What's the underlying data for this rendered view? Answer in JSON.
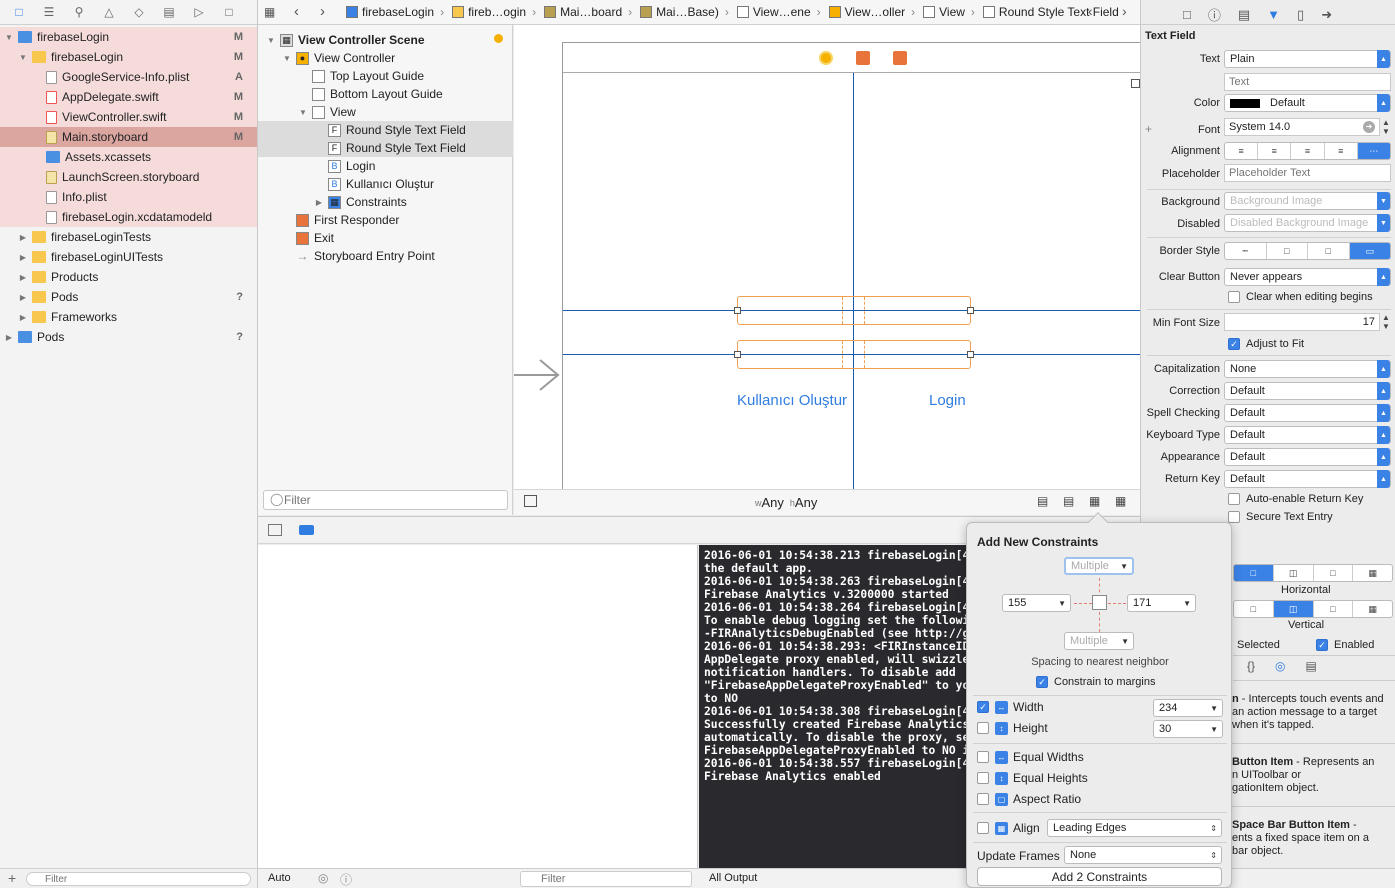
{
  "navigator": {
    "rows": [
      {
        "label": "firebaseLogin",
        "badge": "M",
        "kind": "project",
        "indent": 0,
        "disclosure": "open"
      },
      {
        "label": "firebaseLogin",
        "badge": "M",
        "kind": "folder",
        "indent": 1,
        "disclosure": "open"
      },
      {
        "label": "GoogleService-Info.plist",
        "badge": "A",
        "kind": "file",
        "indent": 2,
        "disclosure": ""
      },
      {
        "label": "AppDelegate.swift",
        "badge": "M",
        "kind": "swift",
        "indent": 2,
        "disclosure": ""
      },
      {
        "label": "ViewController.swift",
        "badge": "M",
        "kind": "swift",
        "indent": 2,
        "disclosure": ""
      },
      {
        "label": "Main.storyboard",
        "badge": "M",
        "kind": "storyboard",
        "indent": 2,
        "disclosure": ""
      },
      {
        "label": "Assets.xcassets",
        "badge": "",
        "kind": "assets",
        "indent": 2,
        "disclosure": ""
      },
      {
        "label": "LaunchScreen.storyboard",
        "badge": "",
        "kind": "storyboard",
        "indent": 2,
        "disclosure": ""
      },
      {
        "label": "Info.plist",
        "badge": "",
        "kind": "file",
        "indent": 2,
        "disclosure": ""
      },
      {
        "label": "firebaseLogin.xcdatamodeld",
        "badge": "",
        "kind": "file",
        "indent": 2,
        "disclosure": ""
      },
      {
        "label": "firebaseLoginTests",
        "badge": "",
        "kind": "folder",
        "indent": 1,
        "disclosure": "closed"
      },
      {
        "label": "firebaseLoginUITests",
        "badge": "",
        "kind": "folder",
        "indent": 1,
        "disclosure": "closed"
      },
      {
        "label": "Products",
        "badge": "",
        "kind": "folder",
        "indent": 1,
        "disclosure": "closed"
      },
      {
        "label": "Pods",
        "badge": "?",
        "kind": "folder",
        "indent": 1,
        "disclosure": "closed"
      },
      {
        "label": "Frameworks",
        "badge": "",
        "kind": "folder",
        "indent": 1,
        "disclosure": "closed"
      },
      {
        "label": "Pods",
        "badge": "?",
        "kind": "project",
        "indent": 0,
        "disclosure": "closed"
      }
    ],
    "selected_index": 5,
    "filter_placeholder": "Filter"
  },
  "jumpbar": {
    "crumbs": [
      "firebaseLogin",
      "fireb…ogin",
      "Mai…board",
      "Mai…Base)",
      "View…ene",
      "View…oller",
      "View",
      "Round Style Text Field"
    ]
  },
  "outline": {
    "rows": [
      {
        "label": "View Controller Scene",
        "indent": 0,
        "disclosure": "open",
        "icon": "scene",
        "bold": true,
        "selected": false
      },
      {
        "label": "View Controller",
        "indent": 1,
        "disclosure": "open",
        "icon": "vc",
        "bold": false,
        "selected": false
      },
      {
        "label": "Top Layout Guide",
        "indent": 2,
        "disclosure": "",
        "icon": "guide",
        "bold": false,
        "selected": false
      },
      {
        "label": "Bottom Layout Guide",
        "indent": 2,
        "disclosure": "",
        "icon": "guide",
        "bold": false,
        "selected": false
      },
      {
        "label": "View",
        "indent": 2,
        "disclosure": "open",
        "icon": "view",
        "bold": false,
        "selected": false
      },
      {
        "label": "Round Style Text Field",
        "indent": 3,
        "disclosure": "",
        "icon": "F",
        "bold": false,
        "selected": true
      },
      {
        "label": "Round Style Text Field",
        "indent": 3,
        "disclosure": "",
        "icon": "F",
        "bold": false,
        "selected": true
      },
      {
        "label": "Login",
        "indent": 3,
        "disclosure": "",
        "icon": "B",
        "bold": false,
        "selected": false
      },
      {
        "label": "Kullanıcı Oluştur",
        "indent": 3,
        "disclosure": "",
        "icon": "B",
        "bold": false,
        "selected": false
      },
      {
        "label": "Constraints",
        "indent": 3,
        "disclosure": "closed",
        "icon": "constraints",
        "bold": false,
        "selected": false
      },
      {
        "label": "First Responder",
        "indent": 1,
        "disclosure": "",
        "icon": "responder",
        "bold": false,
        "selected": false
      },
      {
        "label": "Exit",
        "indent": 1,
        "disclosure": "",
        "icon": "exit",
        "bold": false,
        "selected": false
      },
      {
        "label": "Storyboard Entry Point",
        "indent": 1,
        "disclosure": "",
        "icon": "arrow",
        "bold": false,
        "selected": false
      }
    ],
    "filter_placeholder": "Filter"
  },
  "canvas": {
    "button_left": "Kullanıcı Oluştur",
    "button_right": "Login",
    "size_class_w_prefix": "w",
    "size_class_w": "Any",
    "size_class_h_prefix": "h",
    "size_class_h": "Any"
  },
  "console": {
    "text": "2016-06-01 10:54:38.213 firebaseLogin[49\nthe default app.\n2016-06-01 10:54:38.263 firebaseLogin[49\nFirebase Analytics v.3200000 started\n2016-06-01 10:54:38.264 firebaseLogin[49\nTo enable debug logging set the followin\n-FIRAnalyticsDebugEnabled (see http://go\n2016-06-01 10:54:38.293: <FIRInstanceID/\nAppDelegate proxy enabled, will swizzle\nnotification handlers. To disable add\n\"FirebaseAppDelegateProxyEnabled\" to you\nto NO\n2016-06-01 10:54:38.308 firebaseLogin[49\nSuccessfully created Firebase Analytics\nautomatically. To disable the proxy, set\nFirebaseAppDelegateProxyEnabled to NO in\n2016-06-01 10:54:38.557 firebaseLogin[49\nFirebase Analytics enabled",
    "bottom_left_mode": "Auto",
    "filter_placeholder": "Filter",
    "output_mode": "All Output"
  },
  "inspector": {
    "section_title": "Text Field",
    "text_label": "Text",
    "text_value": "Plain",
    "text_placeholder": "Text",
    "color_label": "Color",
    "color_value": "Default",
    "font_label": "Font",
    "font_value": "System 14.0",
    "alignment_label": "Alignment",
    "placeholder_label": "Placeholder",
    "placeholder_placeholder": "Placeholder Text",
    "background_label": "Background",
    "background_placeholder": "Background Image",
    "disabled_label": "Disabled",
    "disabled_placeholder": "Disabled Background Image",
    "border_style_label": "Border Style",
    "clear_button_label": "Clear Button",
    "clear_button_value": "Never appears",
    "clear_editing_label": "Clear when editing begins",
    "min_font_label": "Min Font Size",
    "min_font_value": "17",
    "adjust_fit_label": "Adjust to Fit",
    "capitalization_label": "Capitalization",
    "capitalization_value": "None",
    "correction_label": "Correction",
    "correction_value": "Default",
    "spell_label": "Spell Checking",
    "spell_value": "Default",
    "keyboard_label": "Keyboard Type",
    "keyboard_value": "Default",
    "appearance_label": "Appearance",
    "appearance_value": "Default",
    "return_label": "Return Key",
    "return_value": "Default",
    "auto_return_label": "Auto-enable Return Key",
    "secure_label": "Secure Text Entry",
    "horizontal_label": "Horizontal",
    "vertical_label": "Vertical",
    "selected_label": "Selected",
    "enabled_label": "Enabled",
    "lib1_title": "n",
    "lib1_body": " - Intercepts touch events and\nan action message to a target\nwhen it's tapped.",
    "lib2_title": "Button Item",
    "lib2_body": " - Represents an\nn UIToolbar or\ngationItem object.",
    "lib3_title": "Space Bar Button Item",
    "lib3_body": " -\nents a fixed space item on a\nbar object."
  },
  "constraints_popover": {
    "title": "Add New Constraints",
    "top_value": "Multiple",
    "left_value": "155",
    "right_value": "171",
    "bottom_value": "Multiple",
    "spacing_label": "Spacing to nearest neighbor",
    "constrain_margins_label": "Constrain to margins",
    "width_label": "Width",
    "width_value": "234",
    "height_label": "Height",
    "height_value": "30",
    "equal_widths_label": "Equal Widths",
    "equal_heights_label": "Equal Heights",
    "aspect_label": "Aspect Ratio",
    "align_label": "Align",
    "align_value": "Leading Edges",
    "update_frames_label": "Update Frames",
    "update_frames_value": "None",
    "add_button_label": "Add 2 Constraints"
  }
}
